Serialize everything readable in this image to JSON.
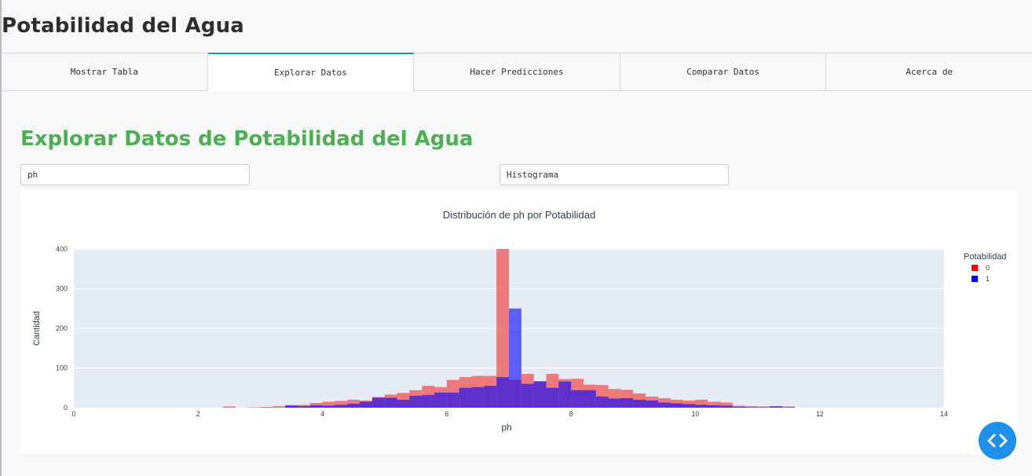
{
  "app": {
    "title": "Potabilidad del Agua"
  },
  "tabs": [
    {
      "label": "Mostrar Tabla",
      "active": false
    },
    {
      "label": "Explorar Datos",
      "active": true
    },
    {
      "label": "Hacer Predicciones",
      "active": false
    },
    {
      "label": "Comparar Datos",
      "active": false
    },
    {
      "label": "Acerca de",
      "active": false
    }
  ],
  "explore": {
    "title": "Explorar Datos de Potabilidad del Agua",
    "variable_select": "ph",
    "chart_type_select": "Histograma"
  },
  "colors": {
    "accent_title": "#4caf50",
    "tab_active_border": "#1a9ab0",
    "series_0": "#ef5350",
    "series_1": "#0000ff",
    "plot_bg": "#e5ecf6",
    "code_button": "#1e90ea"
  },
  "icons": {
    "code_button": "code-brackets-icon"
  },
  "chart_data": {
    "type": "bar",
    "mode": "overlay-histogram",
    "title": "Distribución de ph por Potabilidad",
    "xlabel": "ph",
    "ylabel": "Cantidad",
    "xlim": [
      0,
      14
    ],
    "ylim": [
      0,
      400
    ],
    "x_ticks": [
      0,
      2,
      4,
      6,
      8,
      10,
      12,
      14
    ],
    "y_ticks": [
      0,
      100,
      200,
      300,
      400
    ],
    "legend_title": "Potabilidad",
    "legend_position": "top-right",
    "bin_width": 0.2,
    "x": [
      2.5,
      2.7,
      2.9,
      3.1,
      3.3,
      3.5,
      3.7,
      3.9,
      4.1,
      4.3,
      4.5,
      4.7,
      4.9,
      5.1,
      5.3,
      5.5,
      5.7,
      5.9,
      6.1,
      6.3,
      6.5,
      6.7,
      6.9,
      7.1,
      7.3,
      7.5,
      7.7,
      7.9,
      8.1,
      8.3,
      8.5,
      8.7,
      8.9,
      9.1,
      9.3,
      9.5,
      9.7,
      9.9,
      10.1,
      10.3,
      10.5,
      10.7,
      10.9,
      11.1,
      11.3,
      11.5
    ],
    "series": [
      {
        "name": "0",
        "color": "#ef5350",
        "values": [
          3,
          0,
          1,
          2,
          4,
          5,
          7,
          12,
          15,
          17,
          20,
          18,
          27,
          33,
          37,
          44,
          55,
          52,
          70,
          77,
          80,
          80,
          400,
          70,
          85,
          65,
          85,
          72,
          73,
          58,
          57,
          47,
          45,
          36,
          28,
          24,
          20,
          18,
          20,
          15,
          13,
          5,
          4,
          3,
          4,
          3
        ]
      },
      {
        "name": "1",
        "color": "#0000ff",
        "values": [
          0,
          0,
          0,
          0,
          0,
          6,
          4,
          6,
          5,
          7,
          10,
          15,
          25,
          25,
          20,
          30,
          32,
          38,
          38,
          50,
          52,
          55,
          77,
          250,
          60,
          67,
          50,
          66,
          44,
          44,
          28,
          23,
          24,
          20,
          18,
          13,
          11,
          9,
          7,
          6,
          5,
          2,
          1,
          1,
          3,
          1
        ]
      }
    ]
  }
}
